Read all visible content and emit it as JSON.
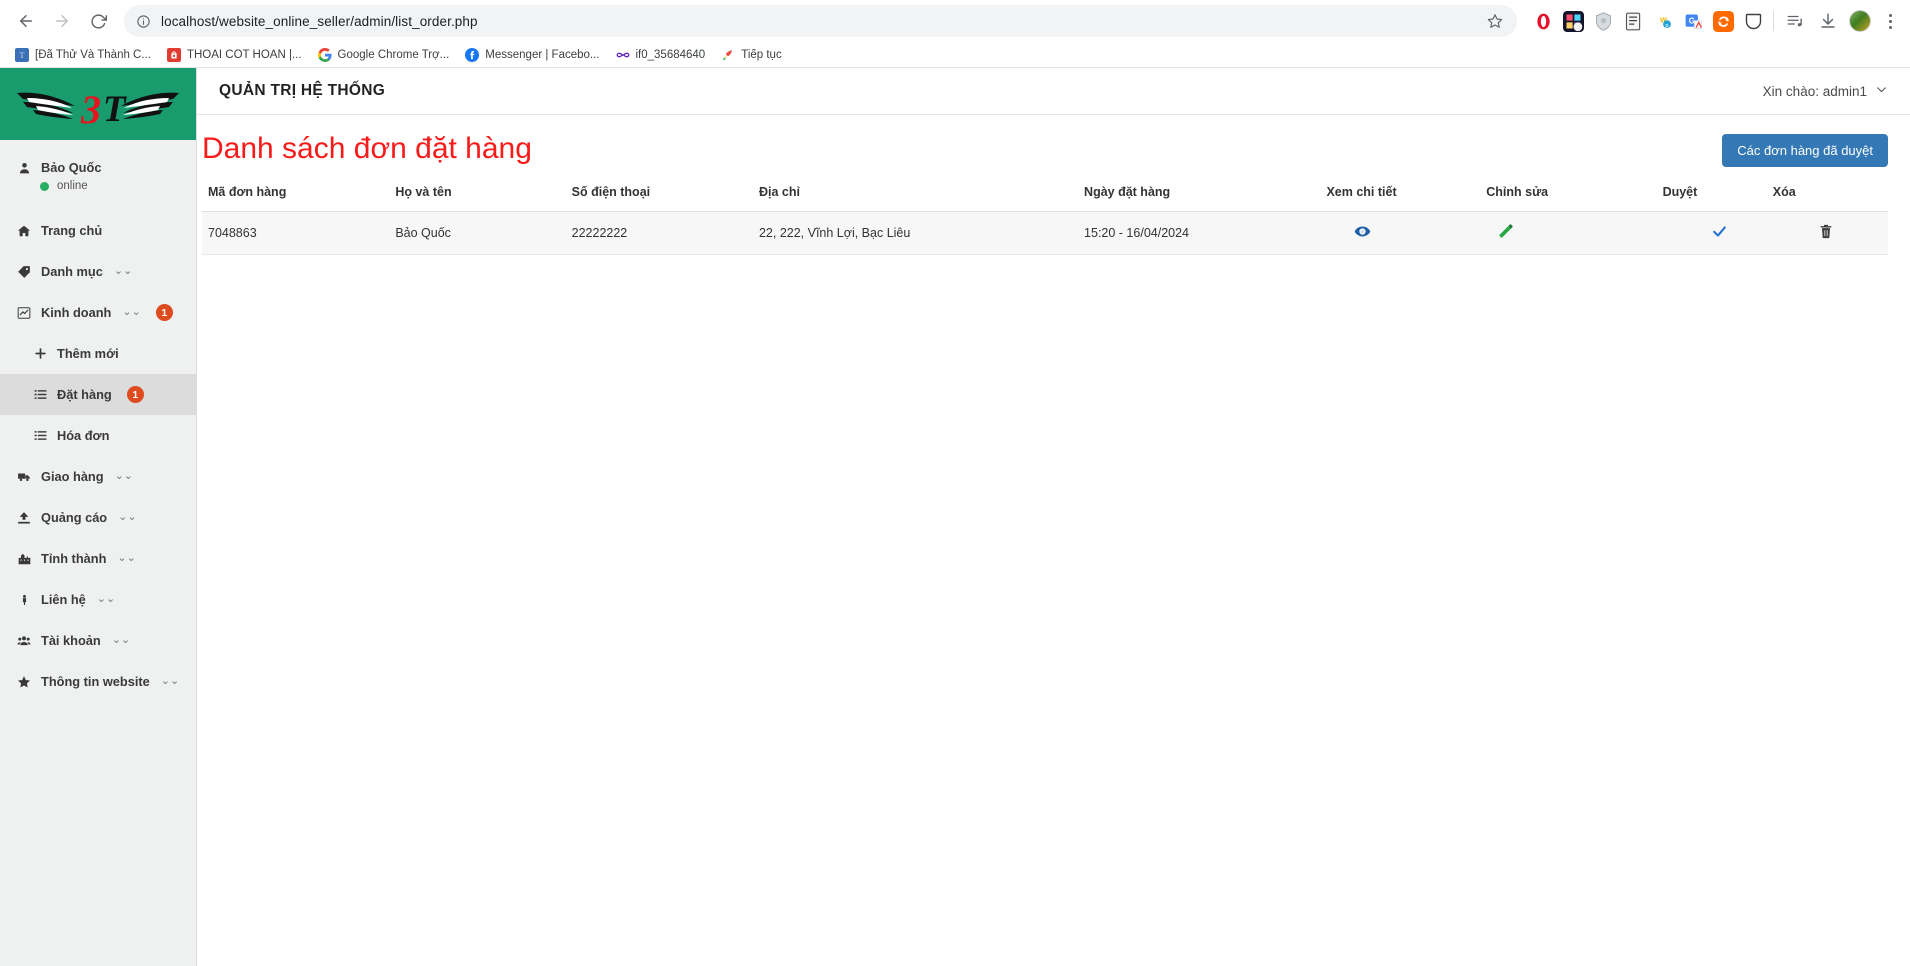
{
  "browser": {
    "url": "localhost/website_online_seller/admin/list_order.php",
    "back_icon": "back-arrow-icon",
    "forward_icon": "forward-arrow-icon",
    "reload_icon": "reload-icon",
    "site_info_icon": "site-info-icon",
    "star_icon": "bookmark-star-icon",
    "menu_icon": "three-dot-menu-icon",
    "extensions": [
      {
        "name": "opera-extension-icon",
        "color": "#ffffff"
      },
      {
        "name": "colorful-extension-icon",
        "color": "#1a1a2e"
      },
      {
        "name": "shield-extension-icon",
        "color": "#e8e8e8"
      },
      {
        "name": "document-extension-icon",
        "color": "#f2f2f2"
      },
      {
        "name": "wp-extension-icon",
        "color": "#ffffff"
      },
      {
        "name": "translate-extension-icon",
        "color": "#ffffff"
      },
      {
        "name": "sync-extension-icon",
        "color": "#ff6a00"
      },
      {
        "name": "pocket-extension-icon",
        "color": "#ffffff"
      }
    ],
    "reading_list_icon": "reading-list-icon",
    "downloads_icon": "downloads-icon",
    "profile_icon": "profile-avatar-icon",
    "bookmarks": [
      {
        "label": "[Đã Thử Và Thành C...",
        "favicon": "blue-square-favicon",
        "color": "#3b6fb6"
      },
      {
        "label": "THOÁI CỐT HOÀN |...",
        "favicon": "red-bag-favicon",
        "color": "#e03c31"
      },
      {
        "label": "Google Chrome Trợ...",
        "favicon": "google-favicon",
        "color": "#ffffff"
      },
      {
        "label": "Messenger | Facebo...",
        "favicon": "facebook-favicon",
        "color": "#1877f2"
      },
      {
        "label": "if0_35684640",
        "favicon": "infinity-favicon",
        "color": "#ffffff"
      },
      {
        "label": "Tiếp tục",
        "favicon": "rocket-favicon",
        "color": "#ffffff"
      }
    ]
  },
  "sidebar": {
    "logo_alt": "3T",
    "user": {
      "name": "Bảo Quốc",
      "status": "online"
    },
    "items": [
      {
        "label": "Trang chủ",
        "icon": "home-icon",
        "caret": false,
        "badge": null,
        "sub": false,
        "active": false
      },
      {
        "label": "Danh mục",
        "icon": "tag-icon",
        "caret": true,
        "badge": null,
        "sub": false,
        "active": false
      },
      {
        "label": "Kinh doanh",
        "icon": "chart-icon",
        "caret": true,
        "badge": "1",
        "sub": false,
        "active": false
      },
      {
        "label": "Thêm mới",
        "icon": "plus-icon",
        "caret": false,
        "badge": null,
        "sub": true,
        "active": false
      },
      {
        "label": "Đặt hàng",
        "icon": "list-icon",
        "caret": false,
        "badge": "1",
        "sub": true,
        "active": true
      },
      {
        "label": "Hóa đơn",
        "icon": "list-icon",
        "caret": false,
        "badge": null,
        "sub": true,
        "active": false
      },
      {
        "label": "Giao hàng",
        "icon": "truck-icon",
        "caret": true,
        "badge": null,
        "sub": false,
        "active": false
      },
      {
        "label": "Quảng cáo",
        "icon": "upload-icon",
        "caret": true,
        "badge": null,
        "sub": false,
        "active": false
      },
      {
        "label": "Tỉnh thành",
        "icon": "city-icon",
        "caret": true,
        "badge": null,
        "sub": false,
        "active": false
      },
      {
        "label": "Liên hệ",
        "icon": "person-icon",
        "caret": true,
        "badge": null,
        "sub": false,
        "active": false
      },
      {
        "label": "Tài khoản",
        "icon": "users-icon",
        "caret": true,
        "badge": null,
        "sub": false,
        "active": false
      },
      {
        "label": "Thông tin website",
        "icon": "star-icon",
        "caret": true,
        "badge": null,
        "sub": false,
        "active": false
      }
    ]
  },
  "topbar": {
    "title": "QUẢN TRỊ HỆ THỐNG",
    "greeting": "Xin chào: admin1",
    "greeting_caret_icon": "chevron-down-icon"
  },
  "page": {
    "title": "Danh sách đơn đặt hàng",
    "approved_button": "Các đơn hàng đã duyệt",
    "accent_red": "#f91a1a",
    "button_blue": "#3479b5"
  },
  "table": {
    "columns": [
      "Mã đơn hàng",
      "Họ và tên",
      "Số điện thoại",
      "Địa chỉ",
      "Ngày đặt hàng",
      "Xem chi tiết",
      "Chỉnh sửa",
      "Duyệt",
      "Xóa"
    ],
    "rows": [
      {
        "ma_don_hang": "7048863",
        "ho_va_ten": "Bảo Quốc",
        "so_dien_thoai": "22222222",
        "dia_chi": "22, 222, Vĩnh Lợi, Bạc Liêu",
        "ngay_dat_hang": "15:20 - 16/04/2024",
        "xem_chi_tiet_icon": "eye-icon",
        "chinh_sua_icon": "pencil-icon",
        "duyet_icon": "check-icon",
        "xoa_icon": "trash-icon"
      }
    ],
    "icon_colors": {
      "eye": "#1f5fa8",
      "pencil": "#28a745",
      "check": "#1f6fd0",
      "trash": "#3d3d3d"
    }
  }
}
